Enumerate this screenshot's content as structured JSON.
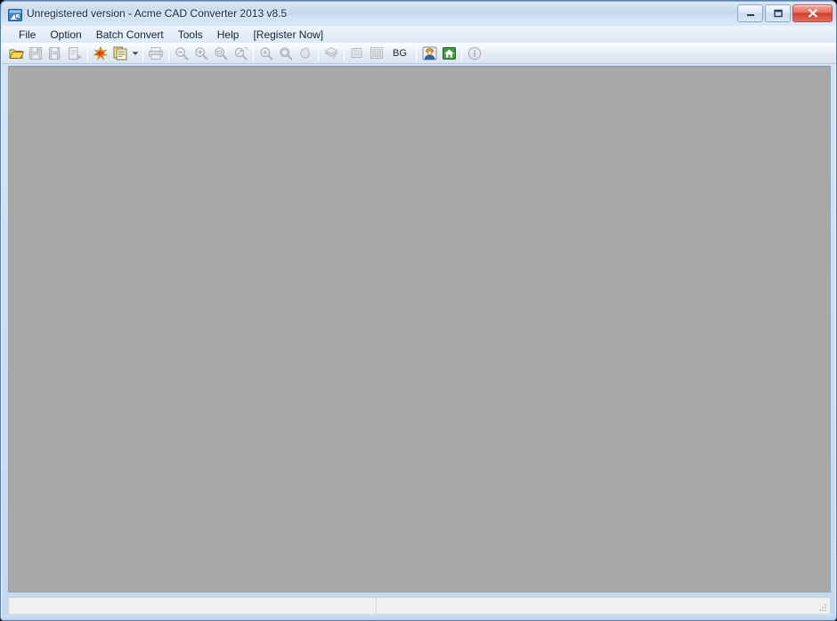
{
  "window": {
    "title": "Unregistered version - Acme CAD Converter 2013 v8.5",
    "icon": "app-icon",
    "controls": {
      "minimize": "Minimize",
      "maximize": "Maximize",
      "close": "Close"
    }
  },
  "menubar": {
    "items": [
      {
        "label": "File",
        "name": "menu-file"
      },
      {
        "label": "Option",
        "name": "menu-option"
      },
      {
        "label": "Batch Convert",
        "name": "menu-batch-convert"
      },
      {
        "label": "Tools",
        "name": "menu-tools"
      },
      {
        "label": "Help",
        "name": "menu-help"
      },
      {
        "label": "[Register Now]",
        "name": "menu-register-now"
      }
    ]
  },
  "toolbar": {
    "buttons": [
      {
        "name": "open-icon",
        "title": "Open",
        "enabled": true
      },
      {
        "name": "save-icon",
        "title": "Save",
        "enabled": false
      },
      {
        "name": "save-as-icon",
        "title": "Save As",
        "enabled": false
      },
      {
        "name": "export-icon",
        "title": "Export",
        "enabled": false
      },
      {
        "name": "convert-icon",
        "title": "Convert",
        "enabled": true
      },
      {
        "name": "batch-convert-icon",
        "title": "Batch Convert",
        "enabled": true
      },
      {
        "name": "print-icon",
        "title": "Print",
        "enabled": false
      },
      {
        "name": "zoom-out-icon",
        "title": "Zoom Out",
        "enabled": false
      },
      {
        "name": "zoom-in-icon",
        "title": "Zoom In",
        "enabled": false
      },
      {
        "name": "zoom-window-icon",
        "title": "Zoom Window",
        "enabled": false
      },
      {
        "name": "zoom-extents-icon",
        "title": "Zoom Extents",
        "enabled": false
      },
      {
        "name": "zoom-previous-icon",
        "title": "Zoom Previous",
        "enabled": false
      },
      {
        "name": "zoom-all-icon",
        "title": "Zoom All",
        "enabled": false
      },
      {
        "name": "pan-icon",
        "title": "Pan",
        "enabled": false
      },
      {
        "name": "layer-icon",
        "title": "Layers",
        "enabled": false
      },
      {
        "name": "page-setup-icon",
        "title": "Page Setup",
        "enabled": false
      },
      {
        "name": "plot-style-icon",
        "title": "Plot Style",
        "enabled": false
      },
      {
        "name": "background-color-button",
        "title": "BG",
        "enabled": true
      },
      {
        "name": "user-icon",
        "title": "User",
        "enabled": true
      },
      {
        "name": "home-icon",
        "title": "Home",
        "enabled": true
      },
      {
        "name": "about-icon",
        "title": "About",
        "enabled": false
      }
    ],
    "bg_label": "BG",
    "dropdown_arrow": "chevron-down-icon"
  },
  "statusbar": {
    "pane1": "",
    "pane2": "",
    "grip": "resize-grip-icon"
  },
  "canvas": {
    "empty": "",
    "background_color": "#a8a8a8"
  },
  "colors": {
    "titlebar_accent": "#bdd4ec",
    "close_button": "#cf3f2c",
    "canvas_gray": "#a8a8a8",
    "toolbar_top": "#fdfefe"
  }
}
